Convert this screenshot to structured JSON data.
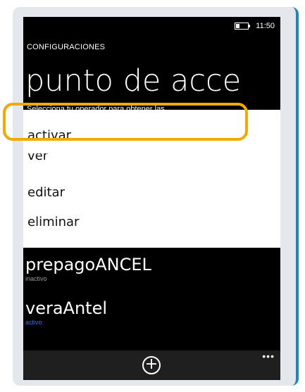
{
  "status": {
    "time": "11:50"
  },
  "header": {
    "section": "CONFIGURACIONES",
    "title": "punto de acce",
    "subtitle": "Selecciona tu operador para obtener las"
  },
  "context_menu": {
    "items": [
      {
        "label": "activar"
      },
      {
        "label": "ver"
      },
      {
        "label": "editar"
      },
      {
        "label": "eliminar"
      }
    ]
  },
  "apn_list": [
    {
      "name": "prepagoANCEL",
      "status": "inactivo",
      "status_color": "#9a9a9a"
    },
    {
      "name": "veraAntel",
      "status": "activo",
      "status_color": "#2d6bff"
    }
  ],
  "appbar": {
    "add_icon": "plus-circle-icon",
    "more_icon": "ellipsis-icon",
    "more_label": "•••"
  },
  "colors": {
    "highlight": "#f2a900",
    "accent_frame": "#1f84c6"
  }
}
